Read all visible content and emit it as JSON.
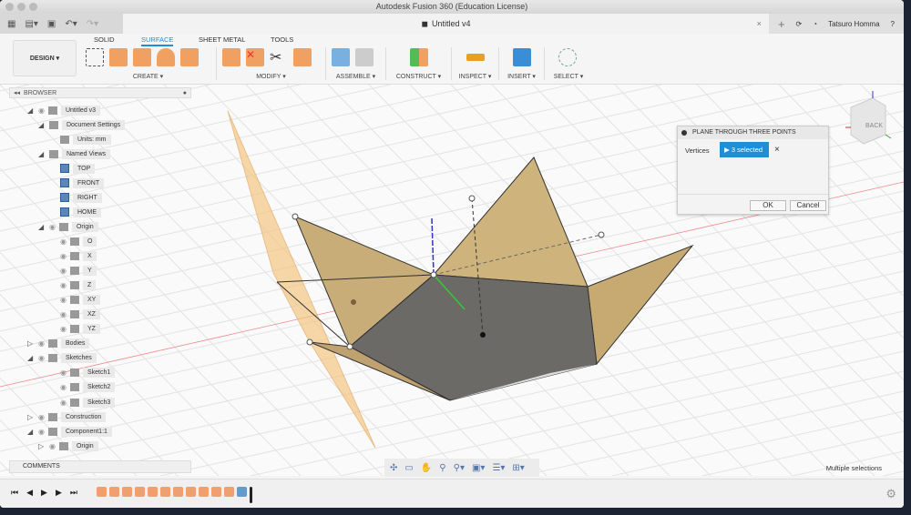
{
  "title": "Autodesk Fusion 360 (Education License)",
  "doc_tab": {
    "name": "Untitled v4"
  },
  "user": "Tatsuro Homma",
  "workspace": "DESIGN ▾",
  "tabs": [
    "SOLID",
    "SURFACE",
    "SHEET METAL",
    "TOOLS"
  ],
  "active_tab": "SURFACE",
  "groups": [
    "CREATE ▾",
    "MODIFY ▾",
    "ASSEMBLE ▾",
    "CONSTRUCT ▾",
    "INSPECT ▾",
    "INSERT ▾",
    "SELECT ▾"
  ],
  "browser": {
    "title": "BROWSER",
    "items": [
      "Untitled v3",
      "Document Settings",
      "Units: mm",
      "Named Views",
      "TOP",
      "FRONT",
      "RIGHT",
      "HOME",
      "Origin",
      "O",
      "X",
      "Y",
      "Z",
      "XY",
      "XZ",
      "YZ",
      "Bodies",
      "Sketches",
      "Sketch1",
      "Sketch2",
      "Sketch3",
      "Construction",
      "Component1:1",
      "Origin"
    ]
  },
  "dialog": {
    "title": "PLANE THROUGH THREE POINTS",
    "label": "Vertices",
    "selection": "3 selected",
    "ok": "OK",
    "cancel": "Cancel"
  },
  "viewcube": {
    "face": "BACK"
  },
  "comments": "COMMENTS",
  "status": "Multiple selections",
  "colors": {
    "accent": "#1e8fd6",
    "surface": "#f0a060"
  }
}
